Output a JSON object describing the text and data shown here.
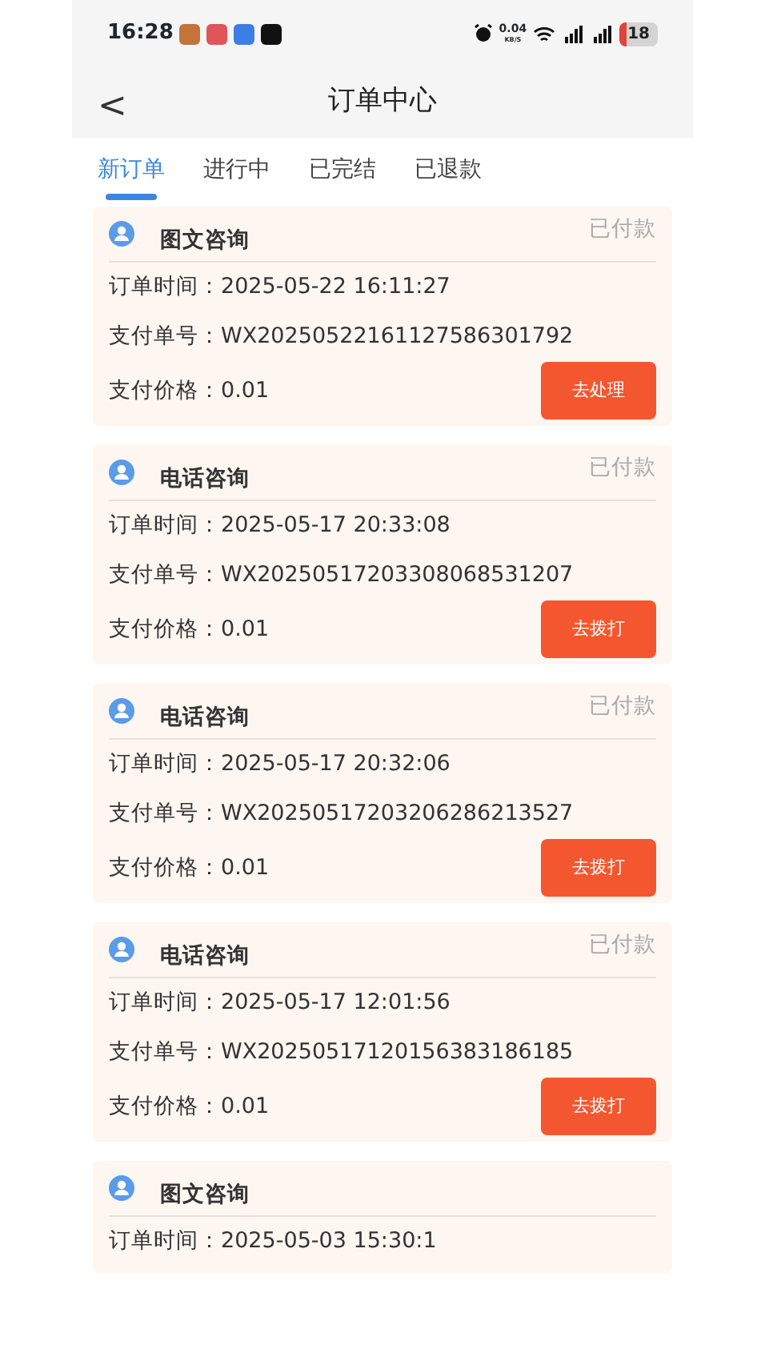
{
  "status_bar": {
    "time": "16:28",
    "net_speed": "0.04",
    "net_unit": "KB/S",
    "battery": "18"
  },
  "header": {
    "back": "<",
    "title": "订单中心"
  },
  "tabs": [
    {
      "label": "新订单",
      "selected": true
    },
    {
      "label": "进行中",
      "selected": false
    },
    {
      "label": "已完结",
      "selected": false
    },
    {
      "label": "已退款",
      "selected": false
    }
  ],
  "orders": [
    {
      "type": "图文咨询",
      "status": "已付款",
      "rows": [
        {
          "label": "订单时间：",
          "value": "2025-05-22 16:11:27"
        },
        {
          "label": "支付单号：",
          "value": "WX20250522161127586301792"
        },
        {
          "label": "支付价格：",
          "value": "0.01"
        }
      ],
      "action": "去处理"
    },
    {
      "type": "电话咨询",
      "status": "已付款",
      "rows": [
        {
          "label": "订单时间：",
          "value": "2025-05-17 20:33:08"
        },
        {
          "label": "支付单号：",
          "value": "WX20250517203308068531207"
        },
        {
          "label": "支付价格：",
          "value": "0.01"
        }
      ],
      "action": "去拨打"
    },
    {
      "type": "电话咨询",
      "status": "已付款",
      "rows": [
        {
          "label": "订单时间：",
          "value": "2025-05-17 20:32:06"
        },
        {
          "label": "支付单号：",
          "value": "WX20250517203206286213527"
        },
        {
          "label": "支付价格：",
          "value": "0.01"
        }
      ],
      "action": "去拨打"
    },
    {
      "type": "电话咨询",
      "status": "已付款",
      "rows": [
        {
          "label": "订单时间：",
          "value": "2025-05-17 12:01:56"
        },
        {
          "label": "支付单号：",
          "value": "WX20250517120156383186185"
        },
        {
          "label": "支付价格：",
          "value": "0.01"
        }
      ],
      "action": "去拨打"
    },
    {
      "type": "图文咨询",
      "rows": [
        {
          "label": "订单时间：",
          "value": "2025-05-03 15:30:1"
        }
      ]
    }
  ]
}
